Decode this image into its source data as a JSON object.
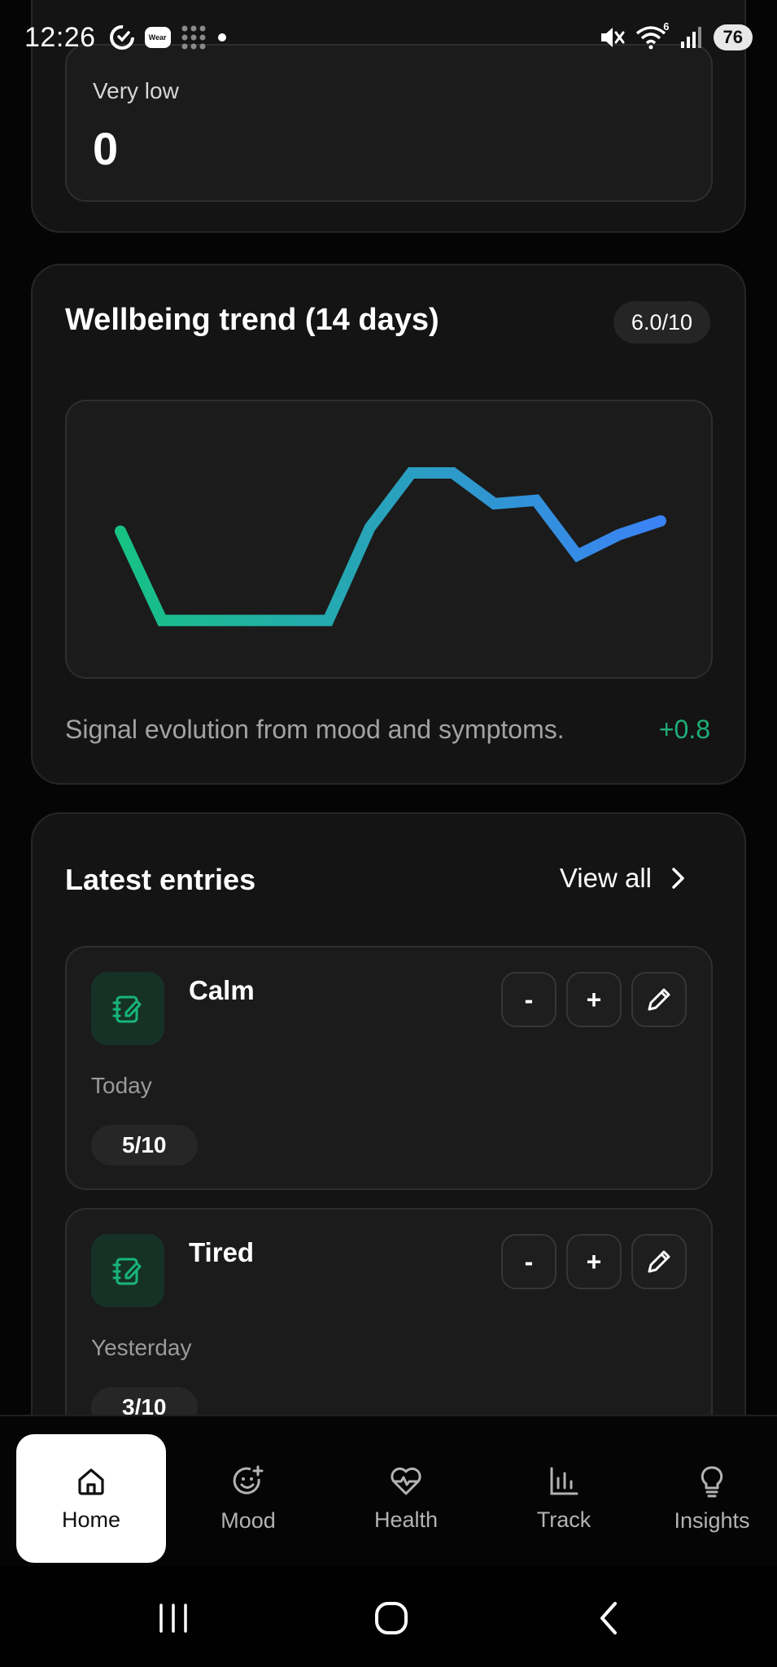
{
  "status_bar": {
    "time": "12:26",
    "wear_label": "Wear",
    "wifi_label": "6",
    "battery": "76"
  },
  "summary": {
    "label": "Very low",
    "value": "0"
  },
  "trend": {
    "title": "Wellbeing trend (14 days)",
    "score": "6.0/10",
    "caption": "Signal evolution from mood and symptoms.",
    "delta": "+0.8",
    "colors": {
      "start": "#17c184",
      "end": "#3b82f6"
    }
  },
  "chart_data": {
    "type": "line",
    "x": [
      1,
      2,
      3,
      4,
      5,
      6,
      7,
      8,
      9,
      10,
      11,
      12,
      13,
      14
    ],
    "values": [
      5.9,
      3.3,
      3.3,
      3.3,
      3.3,
      3.3,
      6.0,
      7.6,
      7.6,
      6.7,
      6.8,
      5.2,
      5.8,
      6.2
    ],
    "ylim": [
      2.5,
      8.5
    ],
    "grid": false
  },
  "entries": {
    "title": "Latest entries",
    "view_all": "View all",
    "items": [
      {
        "name": "Calm",
        "date": "Today",
        "score": "5/10",
        "minus": "-",
        "plus": "+"
      },
      {
        "name": "Tired",
        "date": "Yesterday",
        "score": "3/10",
        "minus": "-",
        "plus": "+"
      }
    ]
  },
  "nav": {
    "items": [
      {
        "label": "Home",
        "icon": "home-icon",
        "active": true
      },
      {
        "label": "Mood",
        "icon": "mood-icon"
      },
      {
        "label": "Health",
        "icon": "heart-pulse-icon"
      },
      {
        "label": "Track",
        "icon": "bar-chart-icon"
      },
      {
        "label": "Insights",
        "icon": "lightbulb-icon"
      }
    ]
  }
}
